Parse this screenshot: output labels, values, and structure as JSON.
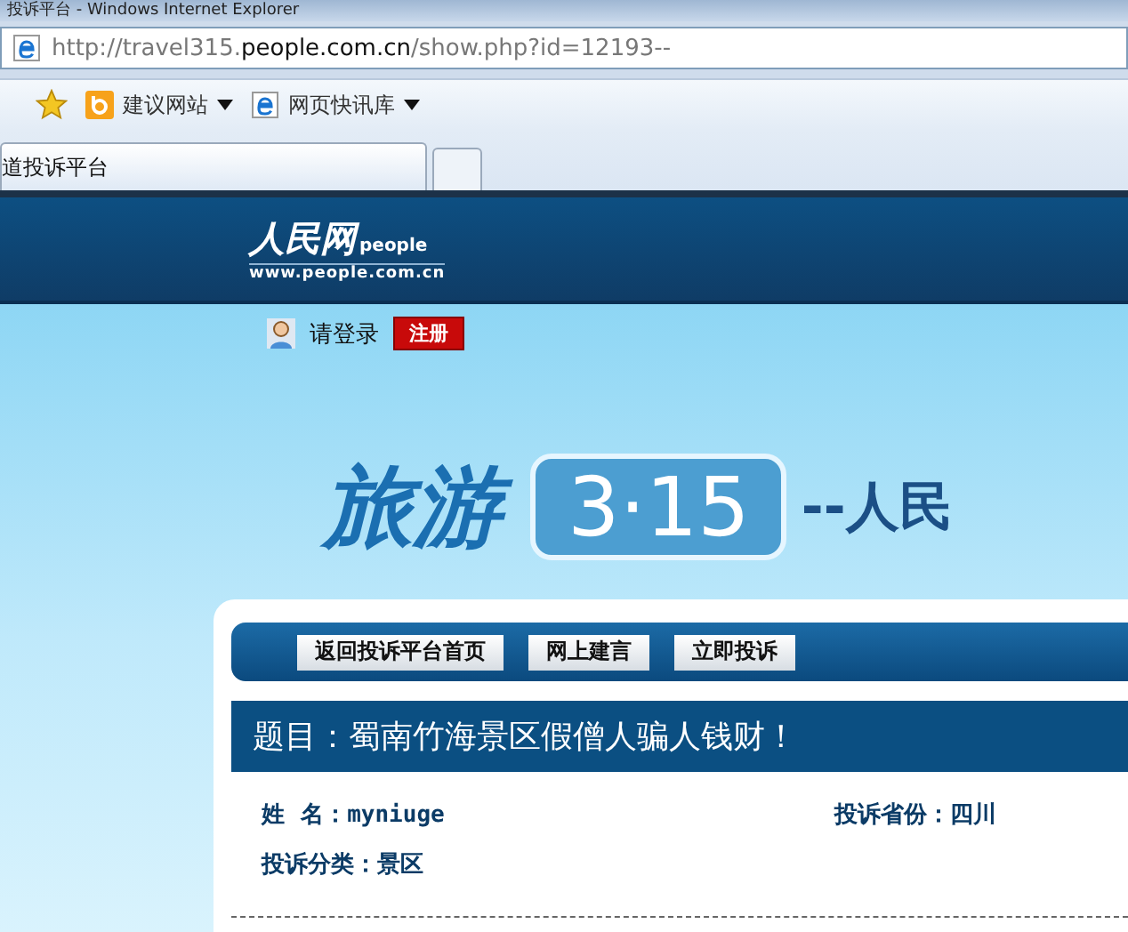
{
  "window": {
    "title": "投诉平台 - Windows Internet Explorer"
  },
  "address_bar": {
    "url_prefix": "http://travel315.",
    "url_domain": "people.com.cn",
    "url_path": "/show.php?id=12193--"
  },
  "favorites_bar": [
    {
      "label": "建议网站",
      "kind": "bing"
    },
    {
      "label": "网页快讯库",
      "kind": "ie"
    }
  ],
  "tabs": [
    {
      "label": "道投诉平台",
      "selected": true
    },
    {
      "selected": false
    }
  ],
  "site_header": {
    "logo_text": "人民网",
    "logo_word": "people",
    "logo_url": "www.people.com.cn"
  },
  "login": {
    "prompt": "请登录",
    "register": "注册"
  },
  "banner": {
    "word": "旅游",
    "badge": "3·15",
    "tail": "--人民"
  },
  "nav_buttons": [
    "返回投诉平台首页",
    "网上建言",
    "立即投诉"
  ],
  "complaint": {
    "title": "题目：蜀南竹海景区假僧人骗人钱财！",
    "fields": [
      {
        "label": "姓  名：",
        "value": "myniuge"
      },
      {
        "label": "投诉省份：",
        "value": "四川"
      },
      {
        "label": "投诉分类：",
        "value": "景区"
      }
    ]
  }
}
